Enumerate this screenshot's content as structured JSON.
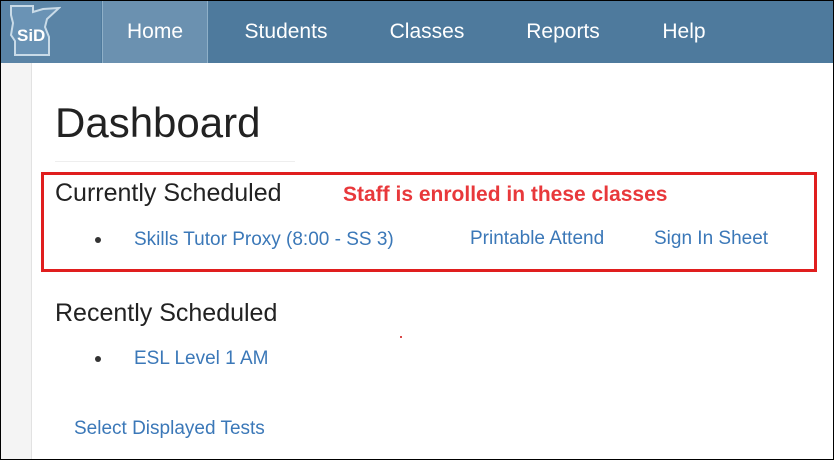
{
  "nav": {
    "logo_text": "SiD",
    "items": [
      {
        "label": "Home",
        "active": true
      },
      {
        "label": "Students"
      },
      {
        "label": "Classes"
      },
      {
        "label": "Reports"
      },
      {
        "label": "Help"
      }
    ]
  },
  "page": {
    "title": "Dashboard",
    "annotation": "Staff is enrolled in these classes",
    "currently_scheduled": {
      "heading": "Currently Scheduled",
      "items": [
        {
          "class_name": "Skills Tutor Proxy (8:00 - SS 3)",
          "printable_attend": "Printable Attend",
          "sign_in_sheet": "Sign In Sheet"
        }
      ]
    },
    "recently_scheduled": {
      "heading": "Recently Scheduled",
      "items": [
        {
          "class_name": "ESL Level 1 AM"
        }
      ]
    },
    "select_tests_link": "Select Displayed Tests"
  },
  "colors": {
    "nav_bg": "#4e7a9d",
    "nav_active": "#6b91b0",
    "link": "#3b78b8",
    "highlight": "#e01e1e",
    "annotation": "#e8383b"
  }
}
